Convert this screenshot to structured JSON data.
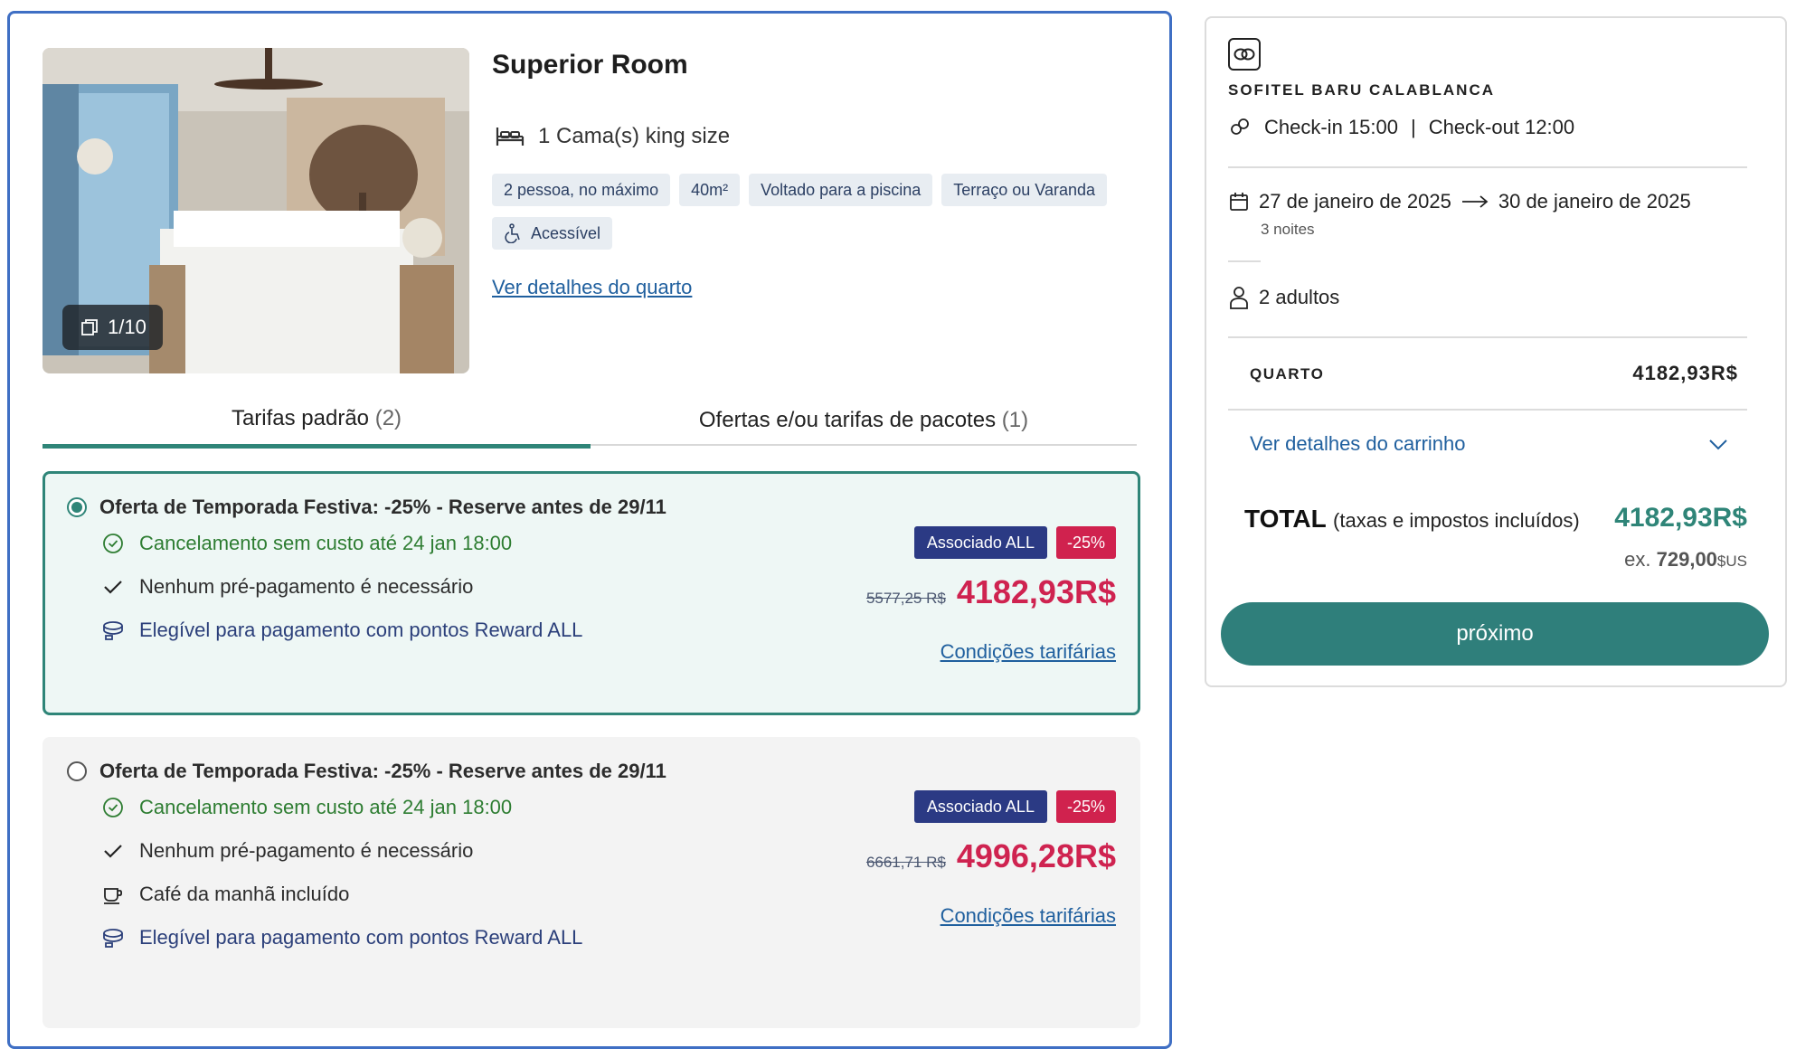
{
  "room": {
    "title": "Superior Room",
    "photo_counter": "1/10",
    "bed": "1 Cama(s) king size",
    "tags": [
      "2 pessoa, no máximo",
      "40m²",
      "Voltado para a piscina",
      "Terraço ou Varanda"
    ],
    "accessible_tag": "Acessível",
    "details_link": "Ver detalhes do quarto"
  },
  "tabs": {
    "standard": {
      "label": "Tarifas padrão",
      "count": "(2)"
    },
    "packages": {
      "label": "Ofertas e/ou tarifas de pacotes",
      "count": "(1)"
    }
  },
  "rates": [
    {
      "title": "Oferta de Temporada Festiva: -25% - Reserve antes de 29/11",
      "selected": true,
      "cancellation": "Cancelamento sem custo até 24 jan 18:00",
      "prepayment": "Nenhum pré-pagamento é necessário",
      "reward": "Elegível para pagamento com pontos Reward ALL",
      "badge_member": "Associado ALL",
      "badge_discount": "-25%",
      "old_price": "5577,25 R$",
      "new_price": "4182,93R$",
      "conditions_link": "Condições tarifárias"
    },
    {
      "title": "Oferta de Temporada Festiva: -25% - Reserve antes de 29/11",
      "selected": false,
      "cancellation": "Cancelamento sem custo até 24 jan 18:00",
      "prepayment": "Nenhum pré-pagamento é necessário",
      "breakfast": "Café da manhã incluído",
      "reward": "Elegível para pagamento com pontos Reward ALL",
      "badge_member": "Associado ALL",
      "badge_discount": "-25%",
      "old_price": "6661,71 R$",
      "new_price": "4996,28R$",
      "conditions_link": "Condições tarifárias"
    }
  ],
  "summary": {
    "hotel_name": "SOFITEL BARU CALABLANCA",
    "checkin": "Check-in 15:00",
    "divider": "|",
    "checkout": "Check-out 12:00",
    "date_from": "27 de janeiro de 2025",
    "date_to": "30 de janeiro de 2025",
    "nights": "3 noites",
    "guests": "2 adultos",
    "room_label": "QUARTO",
    "room_price": "4182,93R$",
    "cart_link": "Ver detalhes do carrinho",
    "total_label": "TOTAL",
    "total_taxes": "(taxas e impostos incluídos)",
    "total_price": "4182,93R$",
    "total_usd_prefix": "ex.",
    "total_usd_value": "729,00",
    "total_usd_currency": "$US",
    "next_button": "próximo"
  },
  "colors": {
    "accent_teal": "#2f8578",
    "price_red": "#cf2350",
    "member_badge": "#2b3a84",
    "discount_badge": "#d0224e",
    "link_blue": "#1f5f9e",
    "card_border_blue": "#3f6fc4"
  },
  "icons": {
    "photo_counter": "gallery-icon",
    "bed": "bed-icon",
    "accessible": "wheelchair-icon",
    "cancellation": "clock-check-icon",
    "prepayment": "checkmark-icon",
    "breakfast": "coffee-cup-icon",
    "reward": "reward-coins-icon",
    "brand": "brand-logo-icon",
    "checkin": "key-icon",
    "calendar": "calendar-icon",
    "arrow": "arrow-right-icon",
    "guests": "person-icon",
    "cart_toggle": "chevron-down-icon"
  }
}
